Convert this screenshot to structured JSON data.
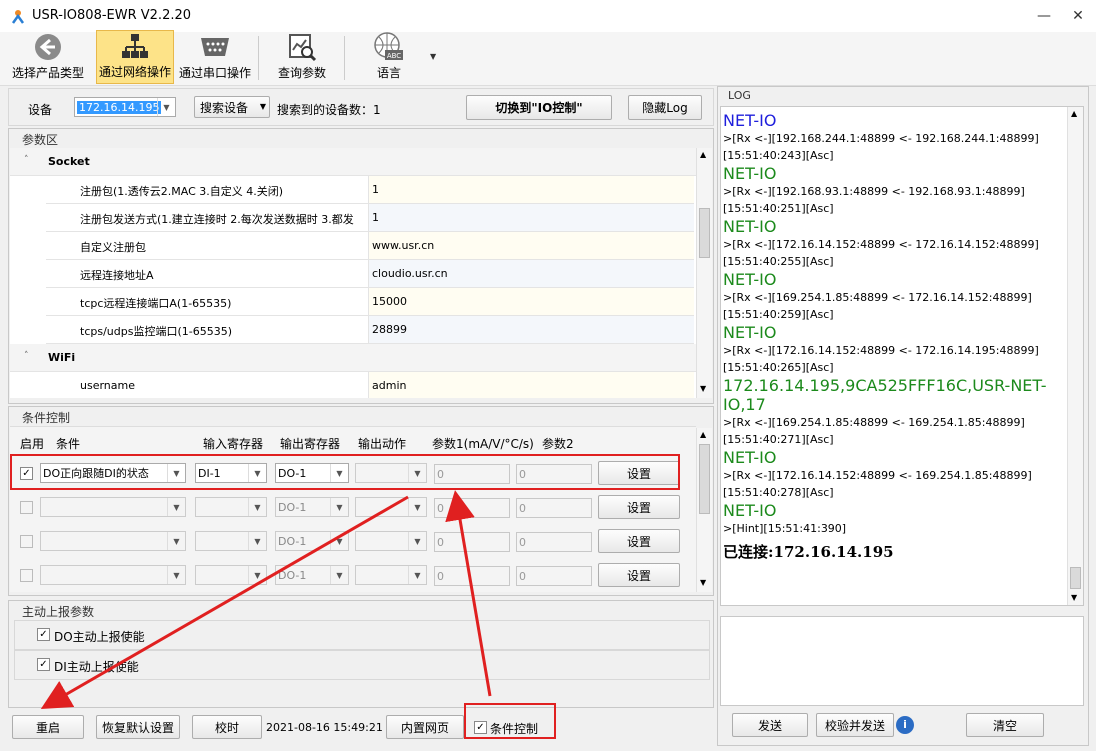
{
  "window": {
    "title": "USR-IO808-EWR V2.2.20"
  },
  "toolbar": {
    "items": [
      {
        "label": "选择产品类型",
        "icon": "back-arrow-icon"
      },
      {
        "label": "通过网络操作",
        "icon": "network-icon"
      },
      {
        "label": "通过串口操作",
        "icon": "serial-port-icon"
      },
      {
        "label": "查询参数",
        "icon": "query-chart-icon"
      },
      {
        "label": "语言",
        "icon": "globe-abc-icon"
      }
    ]
  },
  "device": {
    "label": "设备",
    "selected": "172.16.14.195",
    "search_btn": "搜索设备",
    "found_label": "搜索到的设备数：",
    "found_count": "1",
    "switch_btn": "切换到\"IO控制\"",
    "hide_log_btn": "隐藏Log"
  },
  "params": {
    "title": "参数区",
    "groups": [
      {
        "name": "Socket",
        "rows": [
          {
            "key": "注册包(1.透传云2.MAC 3.自定义 4.关闭)",
            "value": "1"
          },
          {
            "key": "注册包发送方式(1.建立连接时 2.每次发送数据时 3.都发",
            "value": "1"
          },
          {
            "key": "自定义注册包",
            "value": "www.usr.cn"
          },
          {
            "key": "远程连接地址A",
            "value": "cloudio.usr.cn"
          },
          {
            "key": "tcpc远程连接端口A(1-65535)",
            "value": "15000"
          },
          {
            "key": "tcps/udps监控端口(1-65535)",
            "value": "28899"
          }
        ]
      },
      {
        "name": "WiFi",
        "rows": [
          {
            "key": "username",
            "value": "admin"
          }
        ]
      }
    ]
  },
  "cond": {
    "title": "条件控制",
    "headers": [
      "启用",
      "条件",
      "输入寄存器",
      "输出寄存器",
      "输出动作",
      "参数1(mA/V/°C/s)",
      "参数2"
    ],
    "rows": [
      {
        "checked": "✓",
        "condition": "DO正向跟随DI的状态",
        "input": "DI-1",
        "output": "DO-1",
        "p1": "0",
        "p2": "0",
        "btn": "设置"
      },
      {
        "checked": "",
        "condition": "",
        "input": "",
        "output": "DO-1",
        "p1": "0",
        "p2": "0",
        "btn": "设置"
      },
      {
        "checked": "",
        "condition": "",
        "input": "",
        "output": "DO-1",
        "p1": "0",
        "p2": "0",
        "btn": "设置"
      },
      {
        "checked": "",
        "condition": "",
        "input": "",
        "output": "DO-1",
        "p1": "0",
        "p2": "0",
        "btn": "设置"
      }
    ]
  },
  "report": {
    "title": "主动上报参数",
    "do_label": "DO主动上报使能",
    "di_label": "DI主动上报使能",
    "check": "✓"
  },
  "bottom": {
    "restart": "重启",
    "restore": "恢复默认设置",
    "calibrate": "校时",
    "time": "2021-08-16 15:49:21 1",
    "builtin_web": "内置网页",
    "cond_ctrl": "条件控制",
    "check": "✓"
  },
  "log": {
    "title": "LOG",
    "entries": [
      {
        "head": "NET-IO",
        "lines": [
          ">[Rx <-][192.168.244.1:48899 <- 192.168.244.1:48899]",
          "[15:51:40:243][Asc]"
        ],
        "color": "blue"
      },
      {
        "head": "NET-IO",
        "lines": [
          ">[Rx <-][192.168.93.1:48899 <- 192.168.93.1:48899]",
          "[15:51:40:251][Asc]"
        ],
        "color": "green"
      },
      {
        "head": "NET-IO",
        "lines": [
          ">[Rx <-][172.16.14.152:48899 <- 172.16.14.152:48899]",
          "[15:51:40:255][Asc]"
        ],
        "color": "green"
      },
      {
        "head": "NET-IO",
        "lines": [
          ">[Rx <-][169.254.1.85:48899 <- 172.16.14.152:48899]",
          "[15:51:40:259][Asc]"
        ],
        "color": "green"
      },
      {
        "head": "NET-IO",
        "lines": [
          ">[Rx <-][172.16.14.152:48899 <- 172.16.14.195:48899]",
          "[15:51:40:265][Asc]"
        ],
        "color": "green"
      },
      {
        "head": "172.16.14.195,9CA525FFF16C,USR-NET-IO,17",
        "lines": [
          ">[Rx <-][169.254.1.85:48899 <- 169.254.1.85:48899]",
          "[15:51:40:271][Asc]"
        ],
        "color": "green"
      },
      {
        "head": "NET-IO",
        "lines": [
          ">[Rx <-][172.16.14.152:48899 <- 169.254.1.85:48899]",
          "[15:51:40:278][Asc]"
        ],
        "color": "green"
      },
      {
        "head": "NET-IO",
        "lines": [
          ">[Hint][15:51:41:390]"
        ],
        "color": "green"
      }
    ],
    "connected": "已连接:172.16.14.195",
    "send": "发送",
    "verify_send": "校验并发送",
    "clear": "清空",
    "info": "i"
  }
}
